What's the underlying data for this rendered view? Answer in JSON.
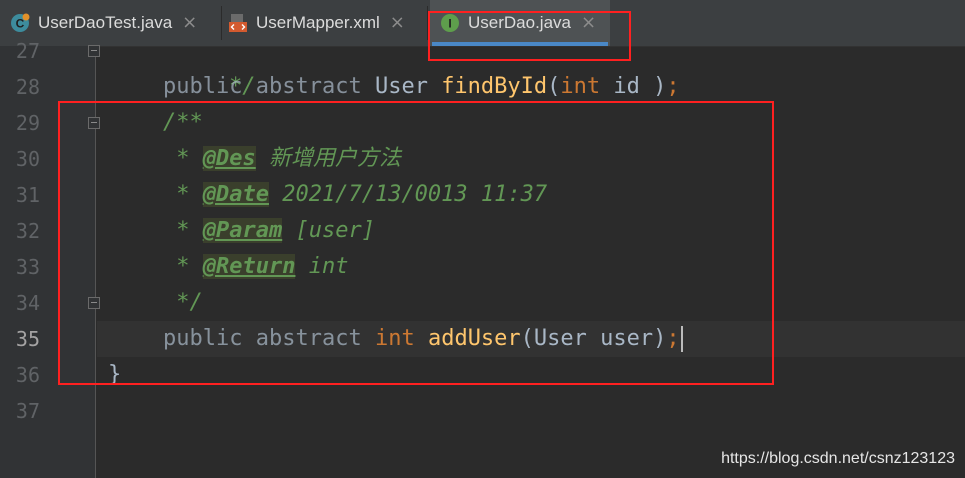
{
  "tabs": [
    {
      "label": "UserDaoTest.java",
      "icon": "java-test-class-icon",
      "active": false
    },
    {
      "label": "UserMapper.xml",
      "icon": "xml-file-icon",
      "active": false
    },
    {
      "label": "UserDao.java",
      "icon": "interface-icon",
      "active": true
    }
  ],
  "tab_close_glyph": "×",
  "interface_icon_letter": "I",
  "line_numbers": [
    "27",
    "28",
    "29",
    "30",
    "31",
    "32",
    "33",
    "34",
    "35",
    "36",
    "37"
  ],
  "current_line": "35",
  "code": {
    "l27_comment": "*/",
    "l28_public": "public",
    "l28_abstract": "abstract",
    "l28_type": "User",
    "l28_method": "findById",
    "l28_lparen": "(",
    "l28_param_type": "int",
    "l28_param_rest": " id )",
    "l28_semi": ";",
    "l29_doc_open": "/**",
    "l30_star": " * ",
    "l30_tag": "@Des",
    "l30_text": " 新增用户方法",
    "l31_star": " * ",
    "l31_tag": "@Date",
    "l31_text": " 2021/7/13/0013 11:37",
    "l32_star": " * ",
    "l32_tag": "@Param",
    "l32_text": " [user]",
    "l33_star": " * ",
    "l33_tag": "@Return",
    "l33_text": " int",
    "l34_doc_close": " */",
    "l35_public": "public",
    "l35_abstract": "abstract",
    "l35_type": "int",
    "l35_method": "addUser",
    "l35_params": "(User user)",
    "l35_semi": ";",
    "l36_brace": "}"
  },
  "watermark": "https://blog.csdn.net/csnz123123",
  "colors": {
    "editor_bg": "#2b2b2b",
    "keyword": "#cc7832",
    "method": "#ffc66d",
    "doc_comment": "#629755",
    "annotation_box": "#ff2020",
    "active_tab_underline": "#4a88c7"
  }
}
